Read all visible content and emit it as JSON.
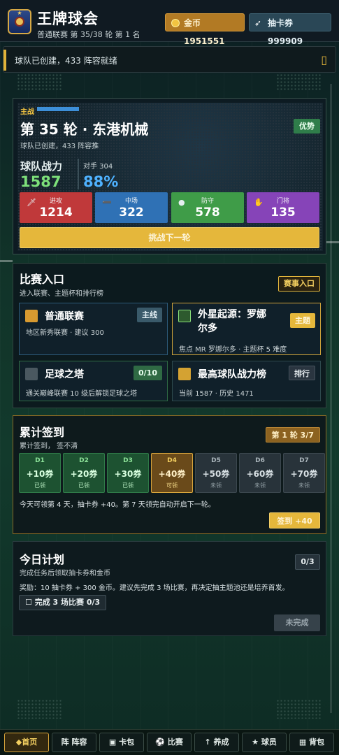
{
  "header": {
    "title": "王牌球会",
    "subtitle": "普通联赛 第 35/38 轮 第 1 名",
    "gold_label": "金币 1951551",
    "ticket_label": "抽卡券 999909"
  },
  "notice": {
    "text": "球队已创建，433 阵容就绪",
    "close_icon": ""
  },
  "hero": {
    "tag": "主战",
    "round_title": "第 35 轮 · 东港机械",
    "round_sub": "球队已创建，433 阵容推",
    "advantage": "优势",
    "power_label": "球队战力",
    "power_value": "1587",
    "opponent_label": "对手 304",
    "win_rate": "88%",
    "stats": [
      {
        "label": "进攻",
        "value": "1214",
        "icon": "sword-icon"
      },
      {
        "label": "中场",
        "value": "322",
        "icon": "boot-icon"
      },
      {
        "label": "防守",
        "value": "578",
        "icon": "shield-icon"
      },
      {
        "label": "门将",
        "value": "135",
        "icon": "glove-icon"
      }
    ],
    "challenge_button": "挑战下一轮"
  },
  "competition": {
    "title": "比赛入口",
    "subtitle": "进入联赛、主题杯和排行榜",
    "entry_button": "赛事入口",
    "cards": [
      {
        "title": "普通联赛",
        "sub": "地区新秀联赛 · 建议 300",
        "badge": "主线"
      },
      {
        "title_line1": "外星起源：罗娜",
        "title_line2": "尔多",
        "sub": "焦点 MR 罗娜尔多 · 主题杯 5 难度",
        "badge": "主题"
      },
      {
        "title": "足球之塔",
        "sub": "通关巅峰联赛 10 级后解锁足球之塔",
        "badge": "0/10"
      },
      {
        "title": "最高球队战力榜",
        "sub": "当前 1587 · 历史 1471",
        "badge": "排行"
      }
    ]
  },
  "signin": {
    "title": "累计签到",
    "subtitle": "累计签到，  签不清",
    "round_badge": "第 1 轮 3/7",
    "days": [
      {
        "day": "D1",
        "reward": "+10券",
        "status": "已领"
      },
      {
        "day": "D2",
        "reward": "+20券",
        "status": "已领"
      },
      {
        "day": "D3",
        "reward": "+30券",
        "status": "已领"
      },
      {
        "day": "D4",
        "reward": "+40券",
        "status": "可领"
      },
      {
        "day": "D5",
        "reward": "+50券",
        "status": "未领"
      },
      {
        "day": "D6",
        "reward": "+60券",
        "status": "未领"
      },
      {
        "day": "D7",
        "reward": "+70券",
        "status": "未领"
      }
    ],
    "note": "今天可领第 4 天，抽卡券 +40。第 7 天领完自动开启下一轮。",
    "button": "签到 +40"
  },
  "plan": {
    "title": "今日计划",
    "subtitle": "完成任务后领取抽卡券和金币",
    "count": "0/3",
    "reward": "奖励：10 抽卡券 + 300 金币。建议先完成 3 场比赛，再决定抽主题池还是培养首发。",
    "task": "☐ 完成 3 场比赛 0/3",
    "status_button": "未完成"
  },
  "nav": [
    {
      "label": "◆首页",
      "active": true
    },
    {
      "label": "阵 阵容"
    },
    {
      "label": "▣ 卡包"
    },
    {
      "label": "⚽ 比赛"
    },
    {
      "label": "↑ 养成"
    },
    {
      "label": "★ 球员"
    },
    {
      "label": "▦ 背包"
    }
  ],
  "colors": {
    "accent_gold": "#e5b73b",
    "win_blue": "#4fb2ff",
    "power_green": "#7de07a"
  }
}
